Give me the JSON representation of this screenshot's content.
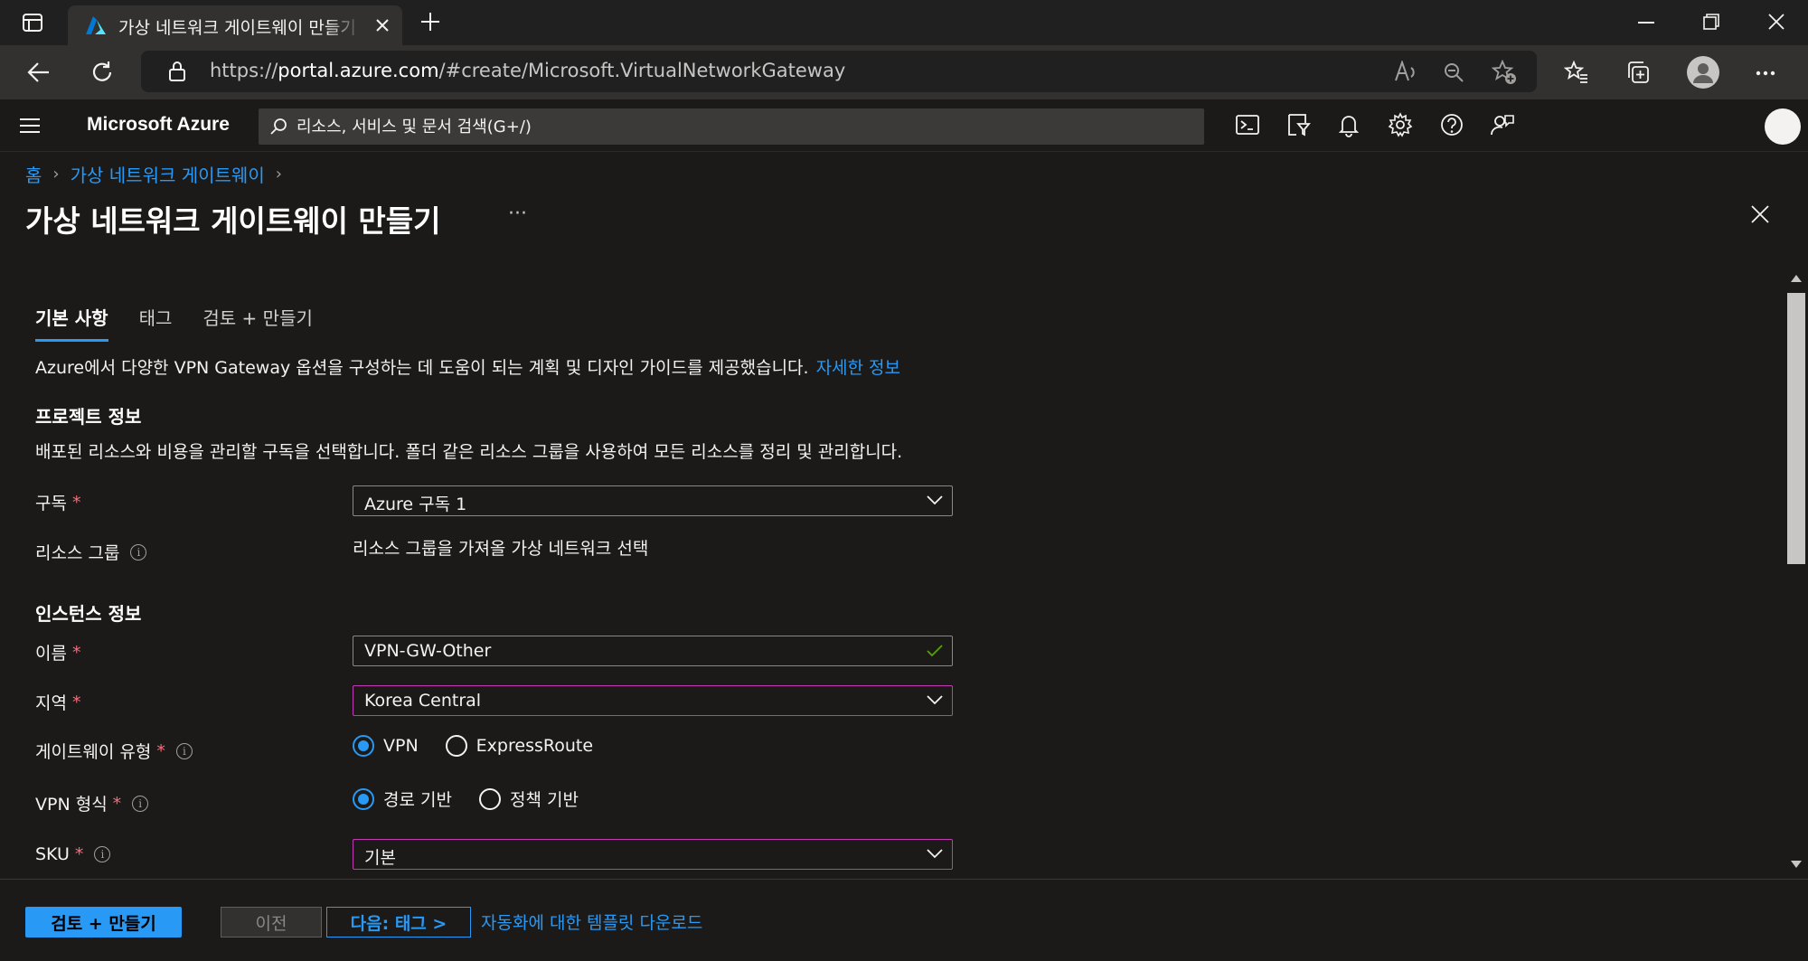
{
  "browser": {
    "tab_title": "가상 네트워크 게이트웨이 만들기",
    "url_scheme": "https://",
    "url_host": "portal.azure.com",
    "url_path": "/#create/Microsoft.VirtualNetworkGateway"
  },
  "azure": {
    "brand": "Microsoft Azure",
    "search_placeholder": "리소스, 서비스 및 문서 검색(G+/)"
  },
  "breadcrumb": [
    "홈",
    "가상 네트워크 게이트웨이"
  ],
  "page": {
    "title": "가상 네트워크 게이트웨이 만들기",
    "more": "···"
  },
  "tabs": [
    "기본 사항",
    "태그",
    "검토 + 만들기"
  ],
  "intro": {
    "text": "Azure에서 다양한 VPN Gateway 옵션을 구성하는 데 도움이 되는 계획 및 디자인 가이드를 제공했습니다.",
    "link": "자세한 정보"
  },
  "project": {
    "heading": "프로젝트 정보",
    "description": "배포된 리소스와 비용을 관리할 구독을 선택합니다. 폴더 같은 리소스 그룹을 사용하여 모든 리소스를 정리 및 관리합니다.",
    "subscription_label": "구독",
    "subscription_value": "Azure 구독 1",
    "resource_group_label": "리소스 그룹",
    "resource_group_value": "리소스 그룹을 가져올 가상 네트워크 선택"
  },
  "instance": {
    "heading": "인스턴스 정보",
    "name_label": "이름",
    "name_value": "VPN-GW-Other",
    "region_label": "지역",
    "region_value": "Korea Central",
    "gateway_type_label": "게이트웨이 유형",
    "gateway_type_options": [
      "VPN",
      "ExpressRoute"
    ],
    "vpn_type_label": "VPN 형식",
    "vpn_type_options": [
      "경로 기반",
      "정책 기반"
    ],
    "sku_label": "SKU",
    "sku_value": "기본"
  },
  "required_mark": "*",
  "info_mark": "i",
  "footer": {
    "review_create": "검토 + 만들기",
    "previous": "이전",
    "next": "다음: 태그 >",
    "download_template": "자동화에 대한 템플릿 다운로드"
  },
  "colors": {
    "accent": "#2899f5",
    "focus_border": "#c239b3",
    "required": "#f1707b",
    "valid_check": "#57a300"
  }
}
